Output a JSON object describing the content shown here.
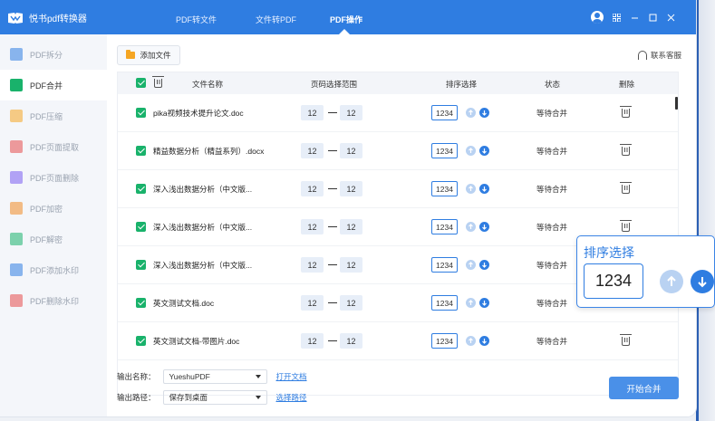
{
  "app": {
    "title": "悦书pdf转换器"
  },
  "nav": {
    "tabs": [
      {
        "label": "PDF转文件"
      },
      {
        "label": "文件转PDF"
      },
      {
        "label": "PDF操作"
      }
    ]
  },
  "sidebar": {
    "items": [
      {
        "label": "PDF拆分",
        "icon": "split-icon",
        "color": "#2f7de1"
      },
      {
        "label": "PDF合并",
        "icon": "merge-icon",
        "color": "#19b26b"
      },
      {
        "label": "PDF压缩",
        "icon": "compress-icon",
        "color": "#f5a623"
      },
      {
        "label": "PDF页面提取",
        "icon": "extract-icon",
        "color": "#e64c4c"
      },
      {
        "label": "PDF页面删除",
        "icon": "delete-page-icon",
        "color": "#7a5cf0"
      },
      {
        "label": "PDF加密",
        "icon": "lock-icon",
        "color": "#f08a24"
      },
      {
        "label": "PDF解密",
        "icon": "unlock-icon",
        "color": "#19b26b"
      },
      {
        "label": "PDF添加水印",
        "icon": "add-watermark-icon",
        "color": "#2f7de1"
      },
      {
        "label": "PDF删除水印",
        "icon": "remove-watermark-icon",
        "color": "#e64c4c"
      }
    ]
  },
  "toolbar": {
    "add_file": "添加文件",
    "support": "联系客服"
  },
  "table": {
    "headers": {
      "filename": "文件名称",
      "page_range": "页码选择范围",
      "order": "排序选择",
      "status": "状态",
      "delete": "删除"
    },
    "rows": [
      {
        "name": "pika视频技术提升论文.doc",
        "from": "12",
        "to": "12",
        "order": "1234",
        "status": "等待合并"
      },
      {
        "name": "精益数据分析（精益系列）.docx",
        "from": "12",
        "to": "12",
        "order": "1234",
        "status": "等待合并"
      },
      {
        "name": "深入浅出数据分析（中文版...",
        "from": "12",
        "to": "12",
        "order": "1234",
        "status": "等待合并"
      },
      {
        "name": "深入浅出数据分析（中文版...",
        "from": "12",
        "to": "12",
        "order": "1234",
        "status": "等待合并"
      },
      {
        "name": "深入浅出数据分析（中文版...",
        "from": "12",
        "to": "12",
        "order": "1234",
        "status": "等待合并"
      },
      {
        "name": "英文测试文档.doc",
        "from": "12",
        "to": "12",
        "order": "1234",
        "status": "等待合并"
      },
      {
        "name": "英文测试文档-带图片.doc",
        "from": "12",
        "to": "12",
        "order": "1234",
        "status": "等待合并"
      }
    ]
  },
  "output": {
    "name_label": "输出名称：",
    "name_value": "YueshuPDF",
    "open_doc": "打开文档",
    "path_label": "输出路径：",
    "path_value": "保存到桌面",
    "choose_path": "选择路径"
  },
  "start_button": "开始合并",
  "popup": {
    "title": "排序选择",
    "order": "1234"
  },
  "colors": {
    "brand": "#2f7de1",
    "check": "#19b26b",
    "button": "#4a90e8"
  }
}
